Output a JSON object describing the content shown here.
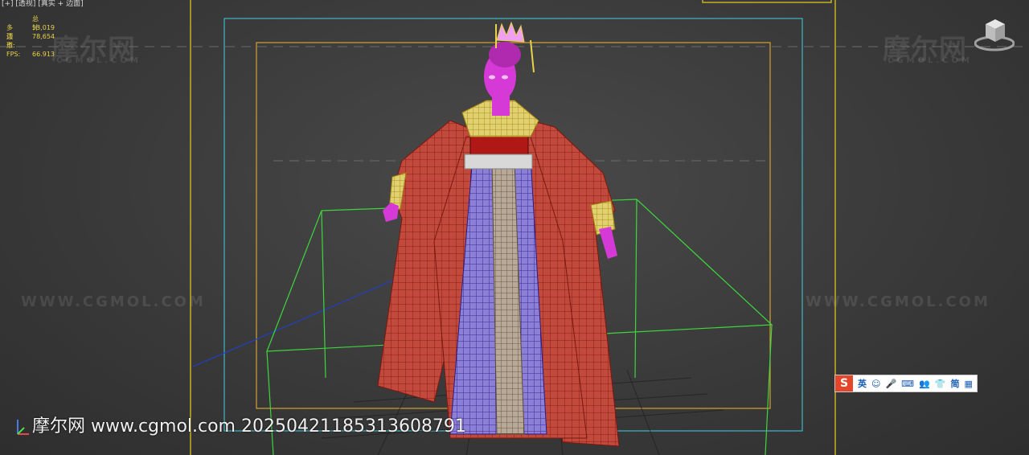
{
  "viewport": {
    "menu_label": "[+] [透视] [真实 + 边面]",
    "stats": {
      "header": "总计",
      "polygons_label": "多边形:",
      "polygons_value": "53,019",
      "vertices_label": "顶点:",
      "vertices_value": "78,654",
      "fps_label": "FPS:",
      "fps_value": "66.913"
    },
    "watermark": {
      "brand": "摩尔网",
      "domain_caps": "WWW.CGMOL.COM",
      "sub": "CGMOL.COM"
    },
    "bottom_caption": "摩尔网 www.cgmol.com 20250421185313608791"
  },
  "ime_toolbar": {
    "logo": "S",
    "items": [
      "英",
      "☺",
      "🎤",
      "⌨",
      "👥",
      "👕",
      "简",
      "▦"
    ]
  },
  "colors": {
    "safe_frame_outer": "#3fb6c8",
    "safe_frame_inner": "#d4a030",
    "viewport_border": "#c8b020",
    "bbox": "#3ed63e",
    "robe": "#c8453a",
    "skin": "#d63ad6",
    "skirt": "#8a7ad0"
  }
}
